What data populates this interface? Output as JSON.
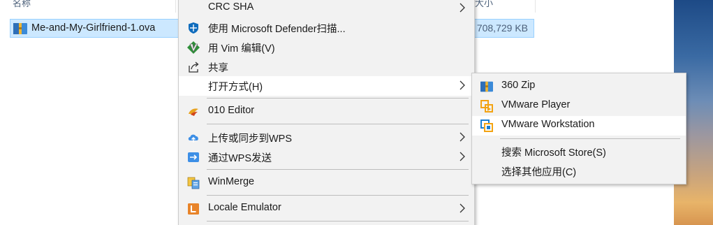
{
  "explorer": {
    "col_name": "名称",
    "col_size": "大小",
    "file": {
      "name": "Me-and-My-Girlfriend-1.ova",
      "size": "708,729 KB",
      "icon": "archive-file-icon"
    }
  },
  "context_menu": {
    "items": [
      {
        "label": "CRC SHA",
        "icon": "",
        "submenu": true
      },
      {
        "label": "使用 Microsoft Defender扫描...",
        "icon": "defender-shield-icon",
        "submenu": false
      },
      {
        "label": "用 Vim 编辑(V)",
        "icon": "vim-icon",
        "submenu": false
      },
      {
        "label": "共享",
        "icon": "share-icon",
        "submenu": false
      },
      {
        "label": "打开方式(H)",
        "icon": "",
        "submenu": true
      },
      {
        "label": "010 Editor",
        "icon": "010-editor-icon",
        "submenu": false
      },
      {
        "label": "上传或同步到WPS",
        "icon": "wps-cloud-icon",
        "submenu": true
      },
      {
        "label": "通过WPS发送",
        "icon": "wps-send-icon",
        "submenu": true
      },
      {
        "label": "WinMerge",
        "icon": "winmerge-icon",
        "submenu": false
      },
      {
        "label": "Locale Emulator",
        "icon": "locale-emulator-icon",
        "submenu": true
      }
    ]
  },
  "open_with_menu": {
    "items": [
      {
        "label": "360 Zip",
        "icon": "360zip-icon"
      },
      {
        "label": "VMware Player",
        "icon": "vmware-player-icon"
      },
      {
        "label": "VMware Workstation",
        "icon": "vmware-workstation-icon"
      },
      {
        "label": "搜索 Microsoft Store(S)",
        "icon": ""
      },
      {
        "label": "选择其他应用(C)",
        "icon": ""
      }
    ]
  },
  "colors": {
    "selection_bg": "#cce8ff",
    "selection_border": "#99d1ff",
    "menu_bg": "#f2f2f2",
    "menu_hover": "#ffffff"
  }
}
